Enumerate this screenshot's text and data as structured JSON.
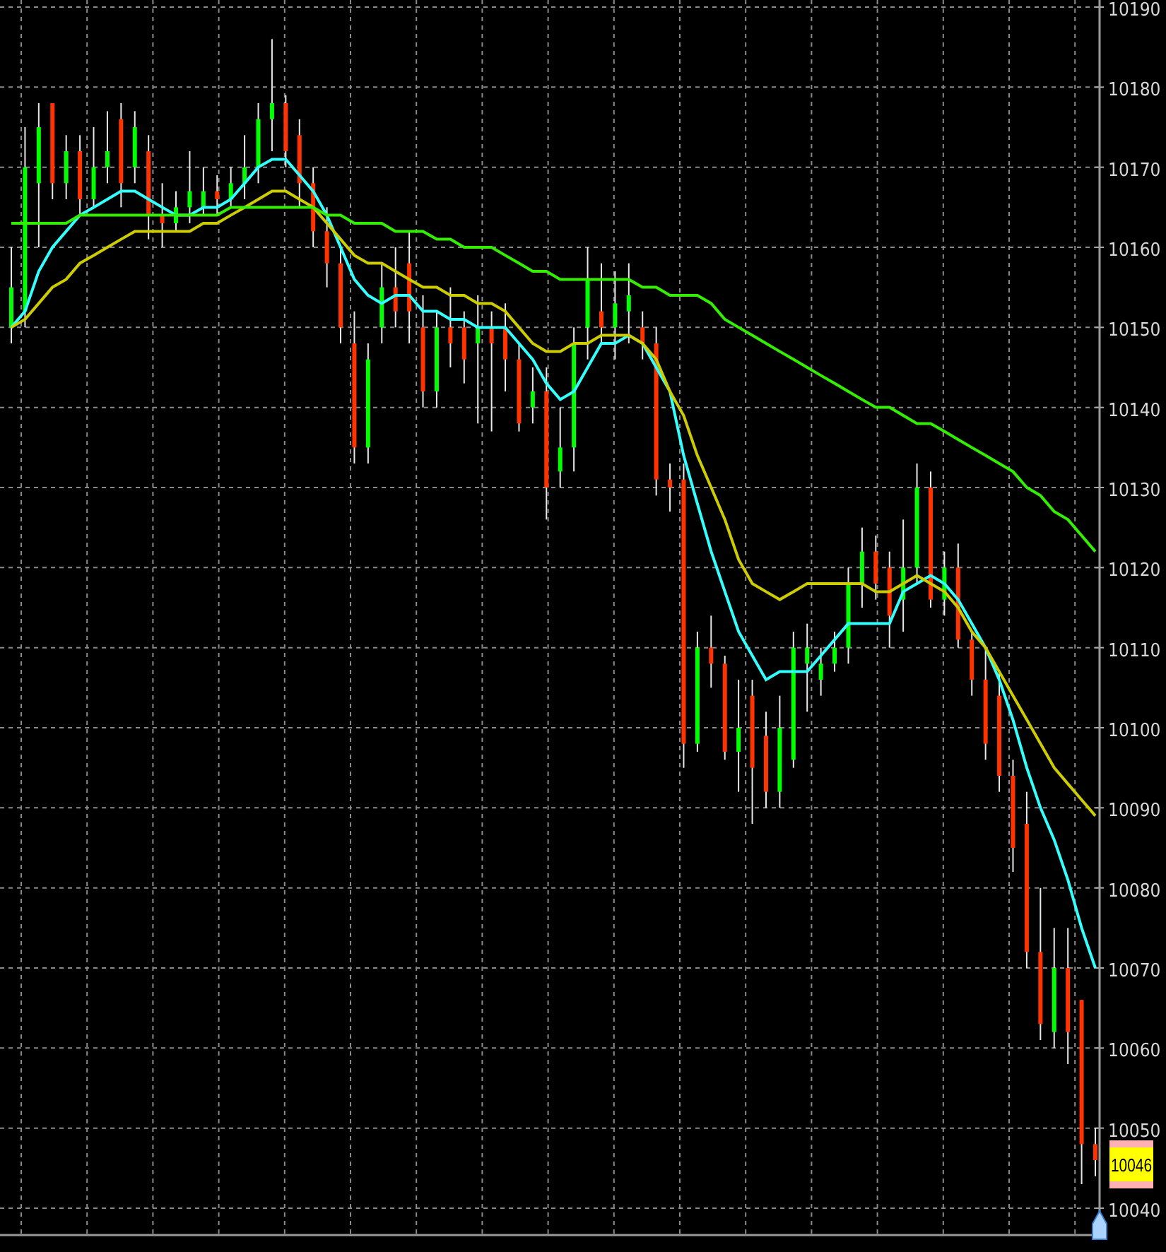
{
  "chart_data": {
    "type": "candlestick",
    "grid": true,
    "ylim": [
      10040,
      10190
    ],
    "yticks": [
      10040,
      10050,
      10060,
      10070,
      10080,
      10090,
      10100,
      10110,
      10120,
      10130,
      10140,
      10150,
      10160,
      10170,
      10180,
      10190
    ],
    "series": [
      {
        "type": "line",
        "color": "#33ffff",
        "values": [
          10150,
          10152,
          10157,
          10160,
          10162,
          10164,
          10165,
          10166,
          10167,
          10167,
          10166,
          10165,
          10164,
          10164,
          10165,
          10165,
          10166,
          10168,
          10170,
          10171,
          10171,
          10169,
          10167,
          10164,
          10160,
          10156,
          10154,
          10153,
          10154,
          10154,
          10152,
          10152,
          10151,
          10151,
          10150,
          10150,
          10150,
          10148,
          10146,
          10143,
          10141,
          10142,
          10145,
          10148,
          10148,
          10149,
          10148,
          10145,
          10142,
          10134,
          10128,
          10122,
          10117,
          10112,
          10109,
          10106,
          10107,
          10107,
          10107,
          10109,
          10111,
          10113,
          10113,
          10113,
          10113,
          10117,
          10118,
          10119,
          10118,
          10116,
          10113,
          10110,
          10106,
          10101,
          10095,
          10090,
          10086,
          10081,
          10075,
          10070
        ]
      },
      {
        "type": "line",
        "color": "#cccc00",
        "values": [
          10150,
          10151,
          10153,
          10155,
          10156,
          10158,
          10159,
          10160,
          10161,
          10162,
          10162,
          10162,
          10162,
          10162,
          10163,
          10163,
          10164,
          10165,
          10166,
          10167,
          10167,
          10166,
          10165,
          10163,
          10161,
          10159,
          10158,
          10158,
          10157,
          10156,
          10155,
          10155,
          10154,
          10154,
          10153,
          10153,
          10152,
          10150,
          10148,
          10147,
          10147,
          10148,
          10148,
          10149,
          10149,
          10149,
          10148,
          10146,
          10142,
          10139,
          10134,
          10130,
          10126,
          10121,
          10118,
          10117,
          10116,
          10117,
          10118,
          10118,
          10118,
          10118,
          10118,
          10117,
          10117,
          10118,
          10119,
          10118,
          10117,
          10115,
          10112,
          10110,
          10107,
          10104,
          10101,
          10098,
          10095,
          10093,
          10091,
          10089
        ]
      },
      {
        "type": "line",
        "color": "#33ee00",
        "values": [
          10163,
          10163,
          10163,
          10163,
          10163,
          10164,
          10164,
          10164,
          10164,
          10164,
          10164,
          10164,
          10164,
          10164,
          10164,
          10164,
          10165,
          10165,
          10165,
          10165,
          10165,
          10165,
          10165,
          10164,
          10164,
          10163,
          10163,
          10163,
          10162,
          10162,
          10162,
          10161,
          10161,
          10160,
          10160,
          10160,
          10159,
          10158,
          10157,
          10157,
          10156,
          10156,
          10156,
          10156,
          10156,
          10156,
          10155,
          10155,
          10154,
          10154,
          10154,
          10153,
          10151,
          10150,
          10149,
          10148,
          10147,
          10146,
          10145,
          10144,
          10143,
          10142,
          10141,
          10140,
          10140,
          10139,
          10138,
          10138,
          10137,
          10136,
          10135,
          10134,
          10133,
          10132,
          10130,
          10129,
          10127,
          10126,
          10124,
          10122
        ]
      }
    ],
    "ohlc": [
      [
        10150,
        10160,
        10148,
        10155
      ],
      [
        10152,
        10175,
        10150,
        10170
      ],
      [
        10168,
        10178,
        10160,
        10175
      ],
      [
        10178,
        10178,
        10166,
        10168
      ],
      [
        10168,
        10174,
        10166,
        10172
      ],
      [
        10172,
        10174,
        10164,
        10166
      ],
      [
        10166,
        10175,
        10165,
        10170
      ],
      [
        10170,
        10177,
        10168,
        10172
      ],
      [
        10176,
        10178,
        10165,
        10168
      ],
      [
        10170,
        10177,
        10168,
        10175
      ],
      [
        10172,
        10174,
        10161,
        10164
      ],
      [
        10164,
        10168,
        10160,
        10163
      ],
      [
        10163,
        10167,
        10162,
        10165
      ],
      [
        10165,
        10172,
        10163,
        10167
      ],
      [
        10165,
        10170,
        10164,
        10167
      ],
      [
        10167,
        10169,
        10164,
        10166
      ],
      [
        10166,
        10170,
        10165,
        10168
      ],
      [
        10168,
        10174,
        10166,
        10170
      ],
      [
        10170,
        10178,
        10168,
        10176
      ],
      [
        10176,
        10186,
        10172,
        10178
      ],
      [
        10178,
        10179,
        10170,
        10172
      ],
      [
        10174,
        10176,
        10165,
        10168
      ],
      [
        10168,
        10170,
        10160,
        10162
      ],
      [
        10162,
        10165,
        10155,
        10158
      ],
      [
        10158,
        10160,
        10148,
        10150
      ],
      [
        10148,
        10152,
        10133,
        10135
      ],
      [
        10135,
        10148,
        10133,
        10146
      ],
      [
        10150,
        10158,
        10148,
        10155
      ],
      [
        10155,
        10160,
        10150,
        10152
      ],
      [
        10158,
        10162,
        10148,
        10152
      ],
      [
        10150,
        10154,
        10140,
        10142
      ],
      [
        10142,
        10152,
        10140,
        10150
      ],
      [
        10150,
        10155,
        10145,
        10148
      ],
      [
        10150,
        10152,
        10143,
        10146
      ],
      [
        10148,
        10154,
        10138,
        10150
      ],
      [
        10150,
        10152,
        10137,
        10148
      ],
      [
        10150,
        10153,
        10142,
        10146
      ],
      [
        10146,
        10148,
        10137,
        10138
      ],
      [
        10140,
        10145,
        10138,
        10142
      ],
      [
        10142,
        10145,
        10126,
        10130
      ],
      [
        10132,
        10140,
        10130,
        10135
      ],
      [
        10135,
        10150,
        10132,
        10148
      ],
      [
        10150,
        10160,
        10146,
        10156
      ],
      [
        10152,
        10158,
        10148,
        10150
      ],
      [
        10150,
        10157,
        10146,
        10153
      ],
      [
        10152,
        10158,
        10148,
        10154
      ],
      [
        10150,
        10152,
        10146,
        10148
      ],
      [
        10148,
        10150,
        10129,
        10131
      ],
      [
        10131,
        10133,
        10127,
        10130
      ],
      [
        10131,
        10133,
        10095,
        10098
      ],
      [
        10098,
        10112,
        10097,
        10110
      ],
      [
        10110,
        10114,
        10105,
        10108
      ],
      [
        10108,
        10109,
        10096,
        10097
      ],
      [
        10097,
        10106,
        10092,
        10100
      ],
      [
        10104,
        10106,
        10088,
        10095
      ],
      [
        10099,
        10102,
        10090,
        10092
      ],
      [
        10092,
        10104,
        10090,
        10100
      ],
      [
        10096,
        10112,
        10095,
        10110
      ],
      [
        10108,
        10113,
        10102,
        10110
      ],
      [
        10106,
        10110,
        10104,
        10108
      ],
      [
        10108,
        10112,
        10107,
        10110
      ],
      [
        10110,
        10120,
        10108,
        10118
      ],
      [
        10118,
        10125,
        10115,
        10122
      ],
      [
        10122,
        10124,
        10116,
        10118
      ],
      [
        10120,
        10122,
        10110,
        10114
      ],
      [
        10116,
        10126,
        10112,
        10120
      ],
      [
        10120,
        10133,
        10118,
        10130
      ],
      [
        10130,
        10132,
        10115,
        10116
      ],
      [
        10116,
        10122,
        10114,
        10120
      ],
      [
        10120,
        10123,
        10110,
        10111
      ],
      [
        10111,
        10112,
        10104,
        10106
      ],
      [
        10106,
        10110,
        10096,
        10098
      ],
      [
        10104,
        10107,
        10092,
        10094
      ],
      [
        10094,
        10096,
        10082,
        10085
      ],
      [
        10088,
        10092,
        10070,
        10072
      ],
      [
        10072,
        10080,
        10061,
        10063
      ],
      [
        10062,
        10075,
        10060,
        10070
      ],
      [
        10070,
        10075,
        10058,
        10062
      ],
      [
        10066,
        10066,
        10043,
        10048
      ],
      [
        10048,
        10050,
        10044,
        10046
      ]
    ]
  },
  "last_price": "10046"
}
